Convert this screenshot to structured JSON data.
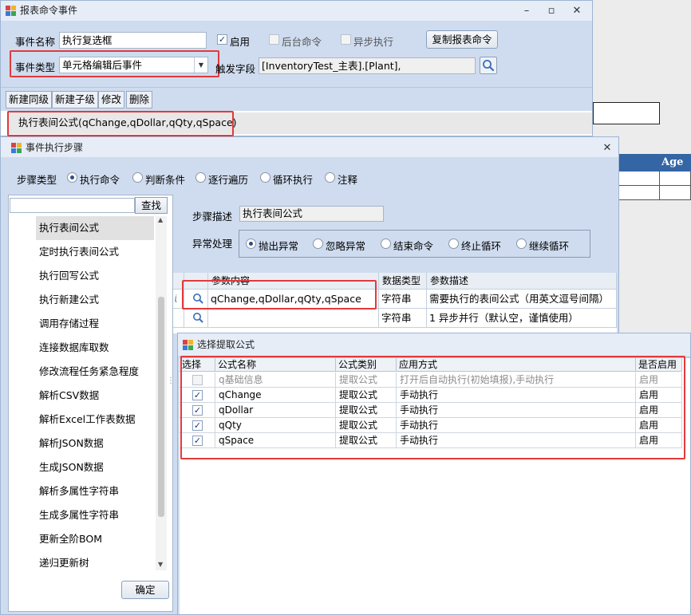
{
  "window_event": {
    "title": "报表命令事件",
    "event_name_label": "事件名称",
    "event_name_value": "执行复选框",
    "enable_label": "启用",
    "background_label": "后台命令",
    "async_label": "异步执行",
    "copy_button": "复制报表命令",
    "event_type_label": "事件类型",
    "event_type_value": "单元格编辑后事件",
    "trigger_field_label": "触发字段",
    "trigger_field_value": "[InventoryTest_主表].[Plant],",
    "toolbar": [
      "新建同级",
      "新建子级",
      "修改",
      "删除"
    ],
    "node_text": "执行表间公式(qChange,qDollar,qQty,qSpace)"
  },
  "window_steps": {
    "title": "事件执行步骤",
    "step_type_label": "步骤类型",
    "step_types": [
      "执行命令",
      "判断条件",
      "逐行遍历",
      "循环执行",
      "注释"
    ],
    "search_button": "查找",
    "list_items": [
      "执行表间公式",
      "定时执行表间公式",
      "执行回写公式",
      "执行新建公式",
      "调用存储过程",
      "连接数据库取数",
      "修改流程任务紧急程度",
      "解析CSV数据",
      "解析Excel工作表数据",
      "解析JSON数据",
      "生成JSON数据",
      "解析多属性字符串",
      "生成多属性字符串",
      "更新全阶BOM",
      "递归更新树"
    ],
    "step_desc_label": "步骤描述",
    "step_desc_value": "执行表间公式",
    "exception_label": "异常处理",
    "exception_options": [
      "抛出异常",
      "忽略异常",
      "结束命令",
      "终止循环",
      "继续循环"
    ],
    "grid_headers": [
      "参数内容",
      "数据类型",
      "参数描述"
    ],
    "grid_rows": [
      {
        "row_mark": "ᶖ",
        "content": "qChange,qDollar,qQty,qSpace",
        "type": "字符串",
        "desc": "需要执行的表间公式（用英文逗号间隔）"
      },
      {
        "row_mark": "",
        "content": "",
        "type": "字符串",
        "desc": "1 异步并行（默认空，谨慎使用）"
      }
    ],
    "ok_button": "确定"
  },
  "window_formula": {
    "title": "选择提取公式",
    "headers": [
      "选择",
      "公式名称",
      "公式类别",
      "应用方式",
      "是否启用"
    ],
    "rows": [
      {
        "checked": false,
        "name": "q基础信息",
        "category": "提取公式",
        "mode": "打开后自动执行(初始填报),手动执行",
        "enabled": "启用"
      },
      {
        "checked": true,
        "name": "qChange",
        "category": "提取公式",
        "mode": "手动执行",
        "enabled": "启用"
      },
      {
        "checked": true,
        "name": "qDollar",
        "category": "提取公式",
        "mode": "手动执行",
        "enabled": "启用"
      },
      {
        "checked": true,
        "name": "qQty",
        "category": "提取公式",
        "mode": "手动执行",
        "enabled": "启用"
      },
      {
        "checked": true,
        "name": "qSpace",
        "category": "提取公式",
        "mode": "手动执行",
        "enabled": "启用"
      }
    ]
  },
  "background": {
    "column_header": "Age"
  },
  "colors": {
    "window_bg": "#cfdcef",
    "titlebar": "#e6edf7",
    "highlight": "#e23a3a",
    "header_blue": "#3465a4"
  }
}
